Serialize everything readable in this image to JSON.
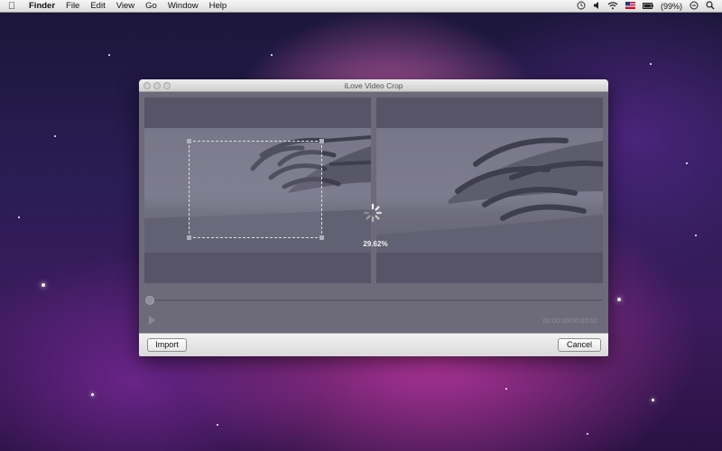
{
  "menubar": {
    "app_name": "Finder",
    "items": [
      "File",
      "Edit",
      "View",
      "Go",
      "Window",
      "Help"
    ],
    "battery": "(99%)"
  },
  "window": {
    "title": "iLove Video Crop",
    "progress_text": "29.62%",
    "time_display": "00:00:00/00:00:52",
    "import_label": "Import",
    "cancel_label": "Cancel"
  },
  "icons": [
    "apple-icon",
    "time-machine-icon",
    "volume-icon",
    "wifi-icon",
    "flag-icon",
    "battery-icon",
    "clock-icon",
    "spotlight-icon",
    "spinner-icon",
    "play-icon"
  ]
}
